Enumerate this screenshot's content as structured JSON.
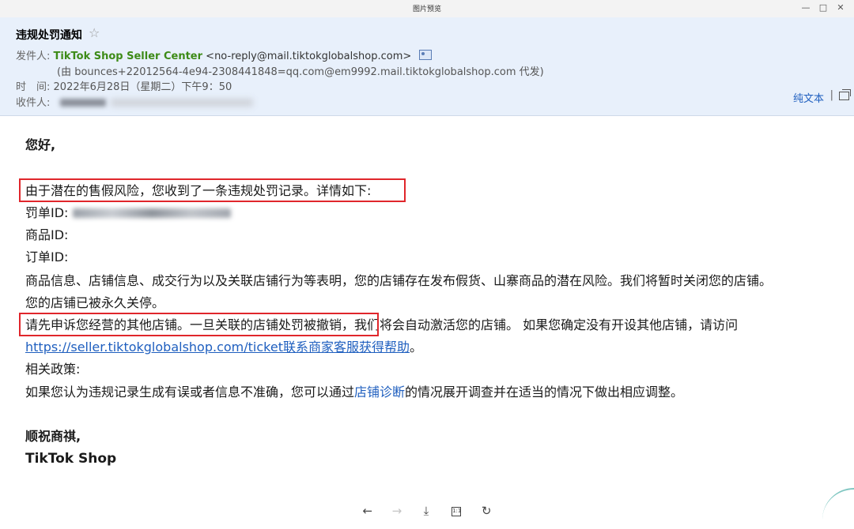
{
  "window": {
    "title": "图片预览",
    "controls": [
      "—",
      "□",
      "✕"
    ]
  },
  "email": {
    "subject": "违规处罚通知",
    "star": "☆",
    "sender_label": "发件人:",
    "sender_name": "TikTok Shop Seller Center",
    "sender_address": "<no-reply@mail.tiktokglobalshop.com>",
    "via": "(由 bounces+22012564-4e94-2308441848=qq.com@em9992.mail.tiktokglobalshop.com 代发)",
    "time_label": "时　间:",
    "time_value": "2022年6月28日（星期二）下午9：50",
    "recipient_label": "收件人:",
    "plain_text_link": "纯文本",
    "separator": "|"
  },
  "body": {
    "greeting": "您好,",
    "intro": "由于潜在的售假风险，您收到了一条违规处罚记录。详情如下:",
    "penalty_id_label": "罚单ID:",
    "product_id_label": "商品ID:",
    "order_id_label": "订单ID:",
    "para1": "商品信息、店铺信息、成交行为以及关联店铺行为等表明，您的店铺存在发布假货、山寨商品的潜在风险。我们将暂时关闭您的店铺。",
    "para2": "您的店铺已被永久关停。",
    "para3": "请先申诉您经营的其他店铺。一旦关联的店铺处罚被撤销，我们将会自动激活您的店铺。 如果您确定没有开设其他店铺，请访问",
    "link": "https://seller.tiktokglobalshop.com/ticket联系商家客服获得帮助",
    "link_suffix": "。",
    "policy_label": "相关政策:",
    "policy_pre": "如果您认为违规记录生成有误或者信息不准确，您可以通过",
    "policy_link": "店铺诊断",
    "policy_post": "的情况展开调查并在适当的情况下做出相应调整。",
    "closing": "顺祝商祺,",
    "signature": "TikTok Shop"
  },
  "toolbar": {
    "back": "←",
    "forward": "→",
    "download": "⤓",
    "actual_size": "1:1",
    "rotate": "↻"
  },
  "colors": {
    "header_bg": "#e8f0fb",
    "sender_green": "#3d8b17",
    "link_blue": "#1f5fbf",
    "highlight_red": "#e0262b"
  }
}
